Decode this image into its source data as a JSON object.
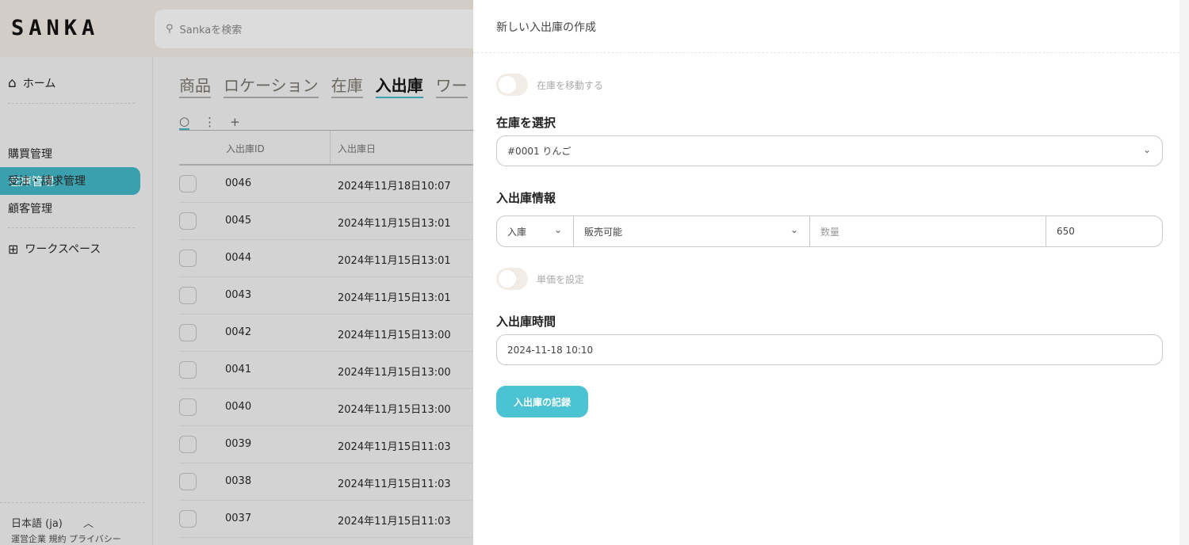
{
  "app": {
    "logo": "SANKA",
    "search_placeholder": "Sankaを検索"
  },
  "sidebar": {
    "home": "ホーム",
    "items": [
      "在庫管理",
      "購買管理",
      "受注・請求管理",
      "顧客管理"
    ],
    "workspace": "ワークスペース",
    "language": "日本語 (ja)",
    "footer": "運営企業 規約 プライバシー"
  },
  "tabs": [
    "商品",
    "ロケーション",
    "在庫",
    "入出庫",
    "ワー"
  ],
  "toolbar": {
    "plus": "+",
    "more": "⋮"
  },
  "table": {
    "headers": [
      "入出庫ID",
      "入出庫日"
    ],
    "rows": [
      [
        "0046",
        "2024年11月18日10:07"
      ],
      [
        "0045",
        "2024年11月15日13:01"
      ],
      [
        "0044",
        "2024年11月15日13:01"
      ],
      [
        "0043",
        "2024年11月15日13:01"
      ],
      [
        "0042",
        "2024年11月15日13:00"
      ],
      [
        "0041",
        "2024年11月15日13:00"
      ],
      [
        "0040",
        "2024年11月15日13:00"
      ],
      [
        "0039",
        "2024年11月15日11:03"
      ],
      [
        "0038",
        "2024年11月15日11:03"
      ],
      [
        "0037",
        "2024年11月15日11:03"
      ]
    ]
  },
  "panel": {
    "title": "新しい入出庫の作成",
    "move_toggle": "在庫を移動する",
    "select_label": "在庫を選択",
    "select_value": "#0001 りんご",
    "info_label": "入出庫情報",
    "direction": "入庫",
    "status": "販売可能",
    "qty_placeholder": "数量",
    "qty_value": "650",
    "price_toggle": "単価を設定",
    "time_label": "入出庫時間",
    "time_value": "2024-11-18 10:10",
    "submit": "入出庫の記録"
  }
}
